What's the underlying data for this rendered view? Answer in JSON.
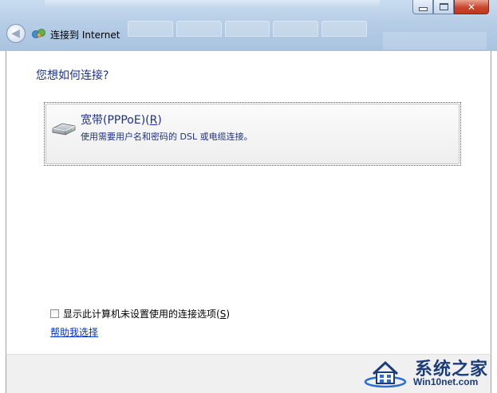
{
  "window": {
    "title": "连接到 Internet"
  },
  "titlebar": {
    "back_icon": "back-arrow-icon",
    "app_icon": "network-connection-icon"
  },
  "main": {
    "question": "您想如何连接?",
    "option": {
      "title": "宽带(PPPoE)(",
      "mnemonic": "R",
      "title_end": ")",
      "description": "使用需要用户名和密码的 DSL 或电缆连接。",
      "icon": "modem-icon"
    },
    "checkbox": {
      "label_start": "显示此计算机未设置使用的连接选项(",
      "mnemonic": "S",
      "label_end": ")",
      "checked": false
    },
    "help_link": "帮助我选择"
  },
  "watermark": {
    "name": "系统之家",
    "site": "Win10net.com"
  },
  "colors": {
    "accent_text": "#1e3287",
    "link": "#0033cc",
    "close_button": "#c9452b"
  }
}
